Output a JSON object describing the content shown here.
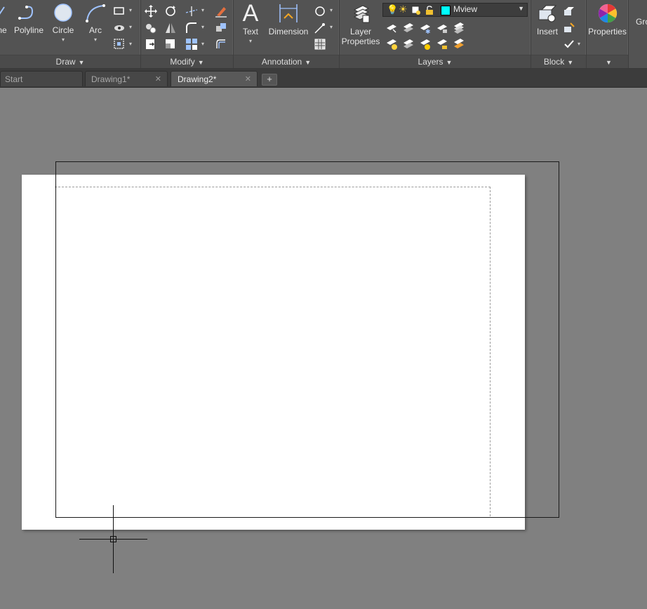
{
  "ribbon": {
    "draw": {
      "title": "Draw",
      "polyline": "Polyline",
      "circle": "Circle",
      "arc": "Arc",
      "line_partial": "ne"
    },
    "modify": {
      "title": "Modify"
    },
    "annotation": {
      "title": "Annotation",
      "text": "Text",
      "dimension": "Dimension"
    },
    "layers": {
      "title": "Layers",
      "layer_properties_1": "Layer",
      "layer_properties_2": "Properties",
      "current_layer": "Mview",
      "current_layer_color": "#00ffff"
    },
    "block": {
      "title": "Block",
      "insert": "Insert"
    },
    "properties": {
      "label": "Properties"
    },
    "groups": {
      "label_partial": "Gro"
    }
  },
  "tabs": [
    {
      "label": "Start",
      "active": false
    },
    {
      "label": "Drawing1*",
      "active": false,
      "close": "✕"
    },
    {
      "label": "Drawing2*",
      "active": true,
      "close": "✕"
    }
  ],
  "new_tab": "+",
  "colors": {
    "ribbon_bg": "#535353",
    "canvas_bg": "#808080",
    "sheet": "#ffffff"
  }
}
